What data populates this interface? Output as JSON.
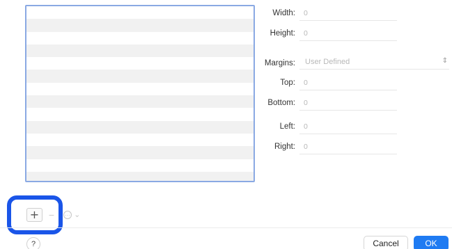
{
  "list": {
    "row_count": 14
  },
  "fields": {
    "width": {
      "label": "Width:",
      "value": "0"
    },
    "height": {
      "label": "Height:",
      "value": "0"
    },
    "margins": {
      "label": "Margins:",
      "value": "User Defined"
    },
    "top": {
      "label": "Top:",
      "value": "0"
    },
    "bottom": {
      "label": "Bottom:",
      "value": "0"
    },
    "left": {
      "label": "Left:",
      "value": "0"
    },
    "right": {
      "label": "Right:",
      "value": "0"
    }
  },
  "toolbar": {
    "add_label": "+",
    "remove_label": "−"
  },
  "footer": {
    "help_label": "?",
    "cancel_label": "Cancel",
    "ok_label": "OK"
  },
  "colors": {
    "accent": "#1f7bf2",
    "highlight": "#1a55e8",
    "list_border": "#8aa9e3"
  }
}
